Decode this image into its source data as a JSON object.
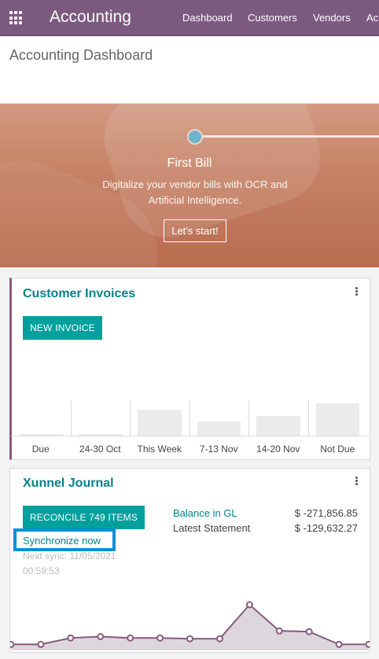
{
  "navbar": {
    "app_title": "Accounting",
    "items": [
      "Dashboard",
      "Customers",
      "Vendors",
      "Ac"
    ]
  },
  "control_panel": {
    "breadcrumb": "Accounting Dashboard"
  },
  "onboarding": {
    "step_title": "First Bill",
    "step_description": "Digitalize your vendor bills with OCR and Artificial Intelligence.",
    "cta_label": "Let's start!"
  },
  "customer_invoices": {
    "title": "Customer Invoices",
    "new_invoice_label": "NEW INVOICE"
  },
  "chart_data": {
    "type": "bar",
    "categories": [
      "Due",
      "24-30 Oct",
      "This Week",
      "7-13 Nov",
      "14-20 Nov",
      "Not Due"
    ],
    "values": [
      0.5,
      0.5,
      8,
      4.5,
      6,
      10
    ],
    "title": "",
    "xlabel": "",
    "ylabel": ""
  },
  "journal": {
    "title": "Xunnel Journal",
    "reconcile_label": "RECONCILE 749 ITEMS",
    "sync_label": "Synchronize now",
    "next_sync": "Next sync: 11/05/2021 00:59:53",
    "balance_gl_label": "Balance in GL",
    "balance_gl_value": "$ -271,856.85",
    "latest_statement_label": "Latest Statement",
    "latest_statement_value": "$ -129,632.27",
    "line_values": [
      0.2,
      0.2,
      0.65,
      0.75,
      0.65,
      0.65,
      0.6,
      0.6,
      3.0,
      1.15,
      1.1,
      0.2,
      0.2
    ]
  },
  "colors": {
    "navbar": "#7c5a7f",
    "accent": "#00838a",
    "button": "#00a09d",
    "highlight": "#0091d6",
    "graph_line": "#875a7b"
  }
}
